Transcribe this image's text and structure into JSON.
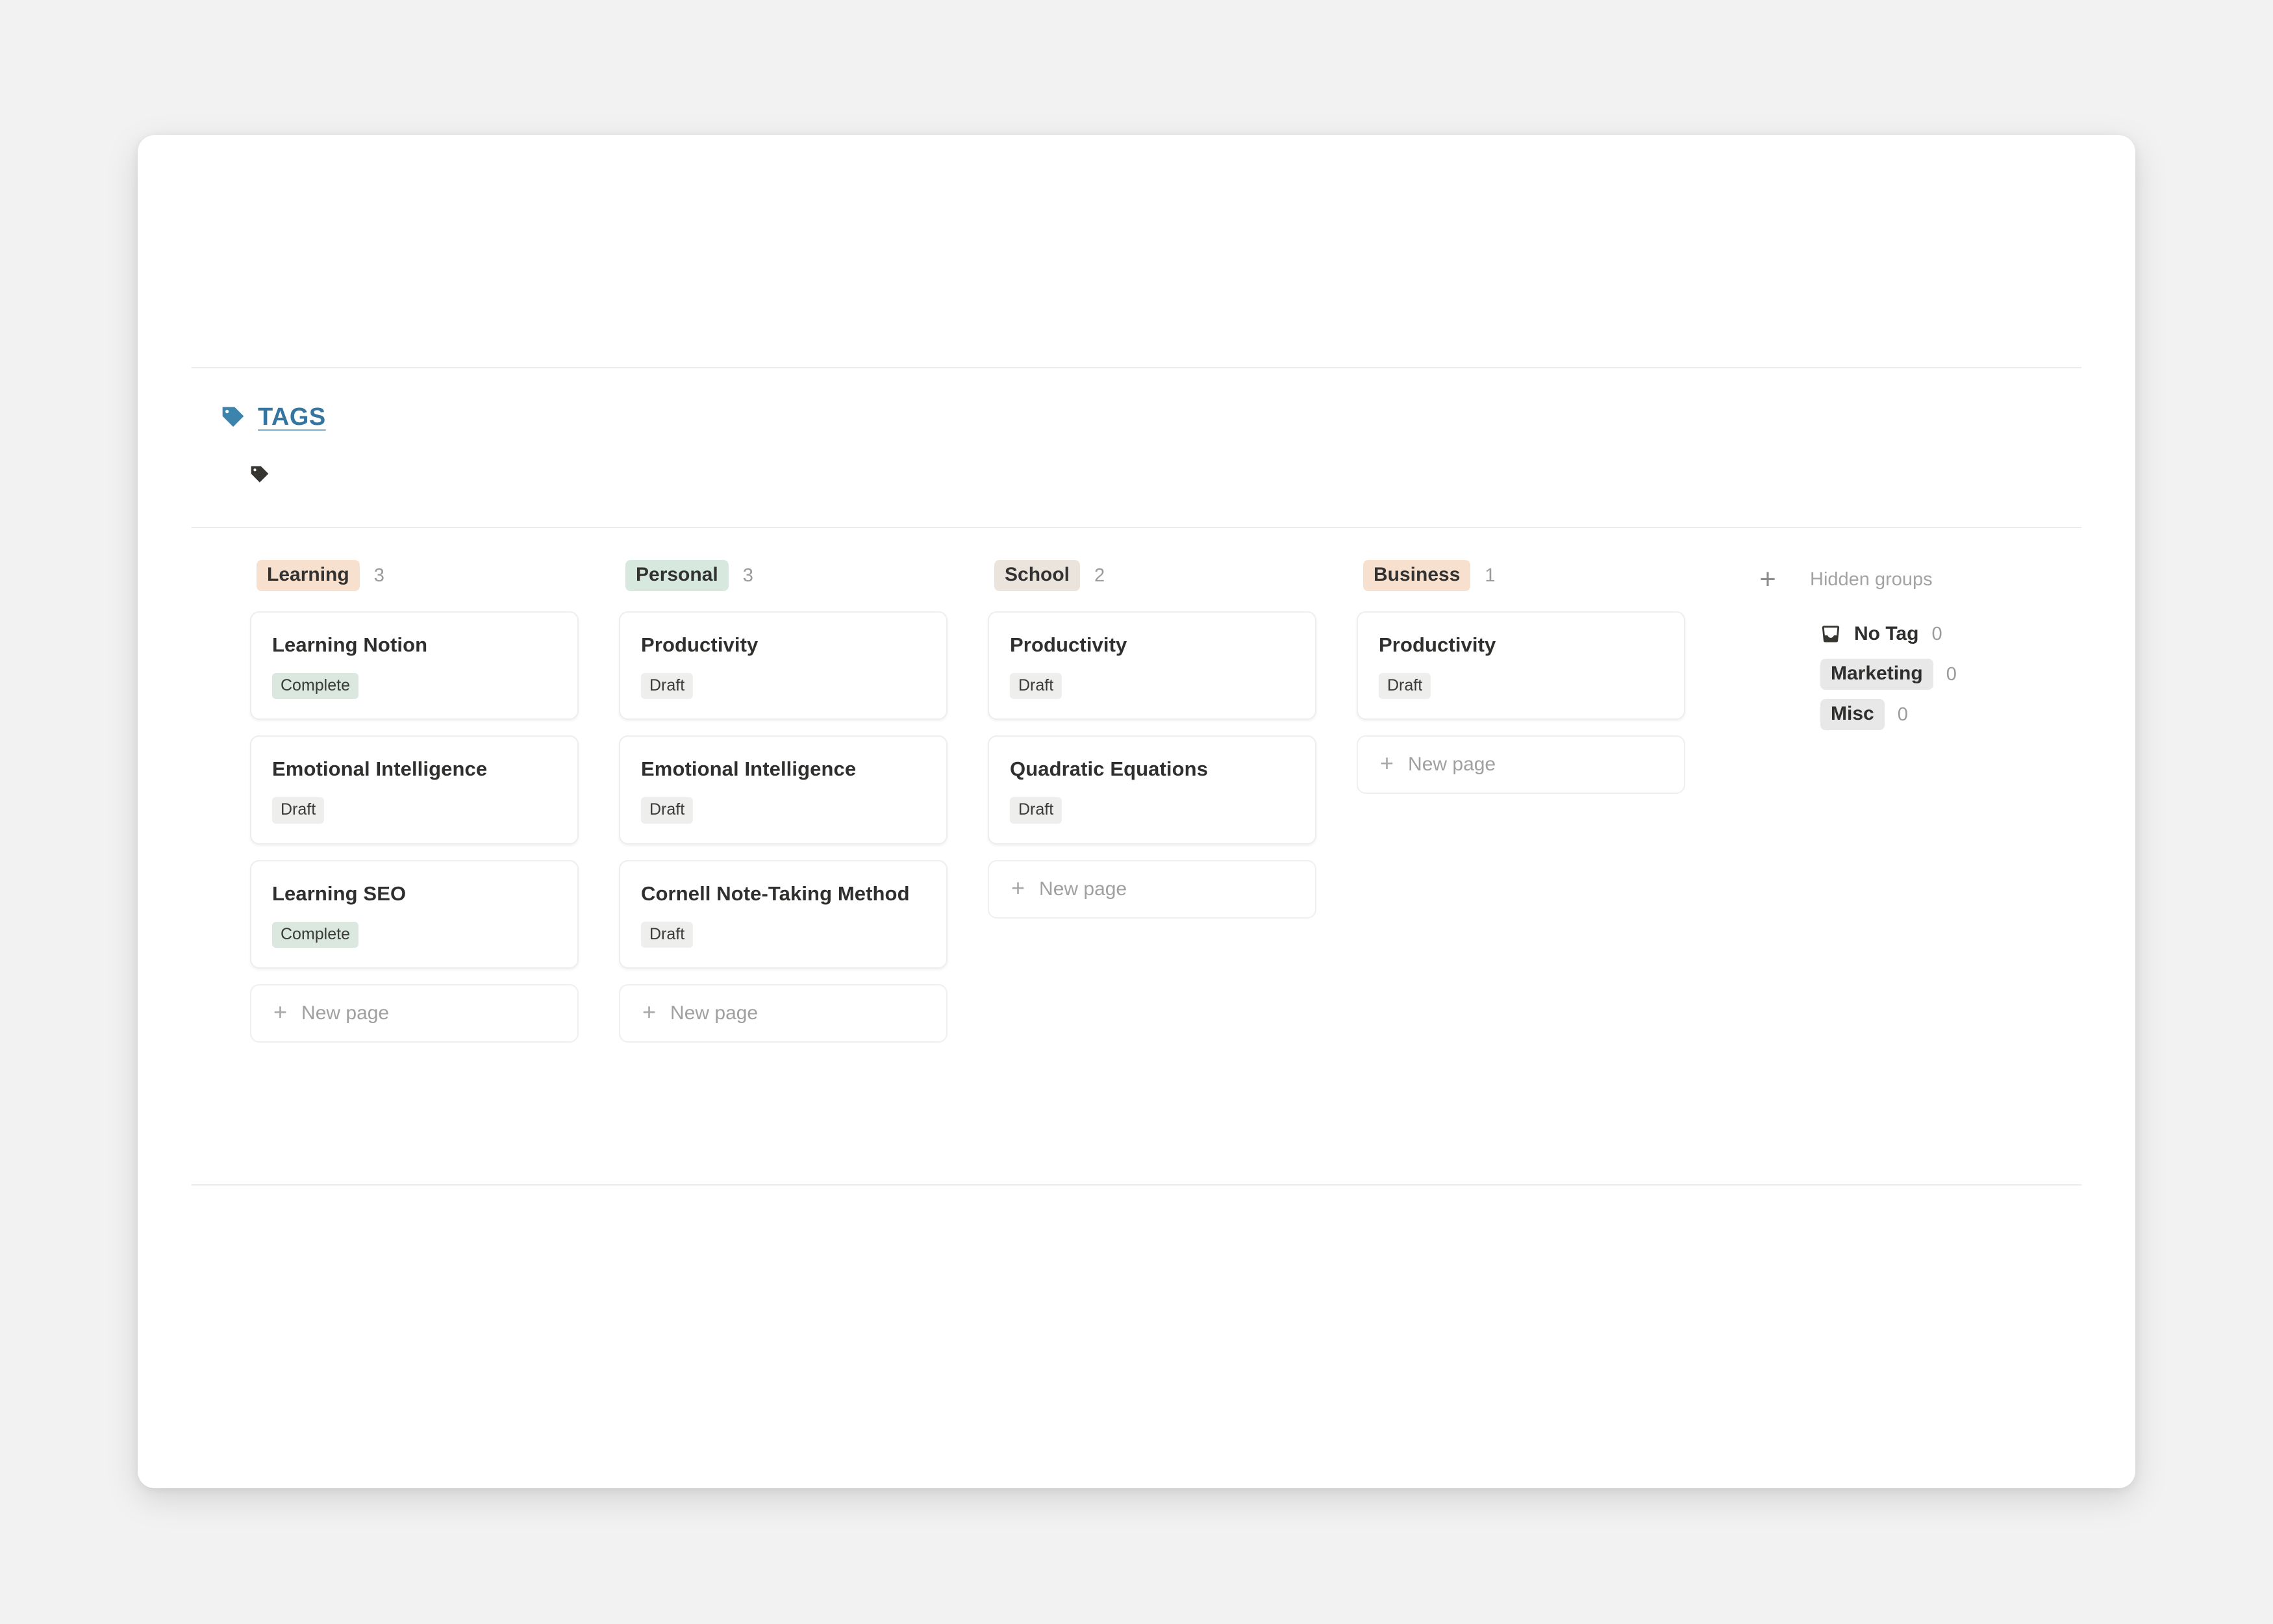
{
  "database": {
    "title": "TAGS",
    "title_icon": "tag-icon",
    "sub_icon": "tag-icon"
  },
  "board": {
    "add_group_label": "+",
    "new_page_label": "New page",
    "new_page_plus": "+",
    "columns": [
      {
        "name": "Learning",
        "chip_color": "#f7e0cd",
        "count": "3",
        "cards": [
          {
            "title": "Learning Notion",
            "status": "Complete",
            "status_color": "#dbe8df"
          },
          {
            "title": "Emotional Intelligence",
            "status": "Draft",
            "status_color": "#eeeeec"
          },
          {
            "title": "Learning SEO",
            "status": "Complete",
            "status_color": "#dbe8df"
          }
        ],
        "has_new_page": true
      },
      {
        "name": "Personal",
        "chip_color": "#d7e8de",
        "count": "3",
        "cards": [
          {
            "title": "Productivity",
            "status": "Draft",
            "status_color": "#eeeeec"
          },
          {
            "title": "Emotional Intelligence",
            "status": "Draft",
            "status_color": "#eeeeec"
          },
          {
            "title": "Cornell Note-Taking Method",
            "status": "Draft",
            "status_color": "#eeeeec"
          }
        ],
        "has_new_page": true
      },
      {
        "name": "School",
        "chip_color": "#ebe4dc",
        "count": "2",
        "cards": [
          {
            "title": "Productivity",
            "status": "Draft",
            "status_color": "#eeeeec"
          },
          {
            "title": "Quadratic Equations",
            "status": "Draft",
            "status_color": "#eeeeec"
          }
        ],
        "has_new_page": true
      },
      {
        "name": "Business",
        "chip_color": "#f7e0cd",
        "count": "1",
        "cards": [
          {
            "title": "Productivity",
            "status": "Draft",
            "status_color": "#eeeeec"
          }
        ],
        "has_new_page": true
      }
    ]
  },
  "hidden_groups": {
    "title": "Hidden groups",
    "items": [
      {
        "label": "No Tag",
        "count": "0",
        "icon": "inbox-icon",
        "chip": false
      },
      {
        "label": "Marketing",
        "count": "0",
        "icon": null,
        "chip": true
      },
      {
        "label": "Misc",
        "count": "0",
        "icon": null,
        "chip": true
      }
    ]
  }
}
